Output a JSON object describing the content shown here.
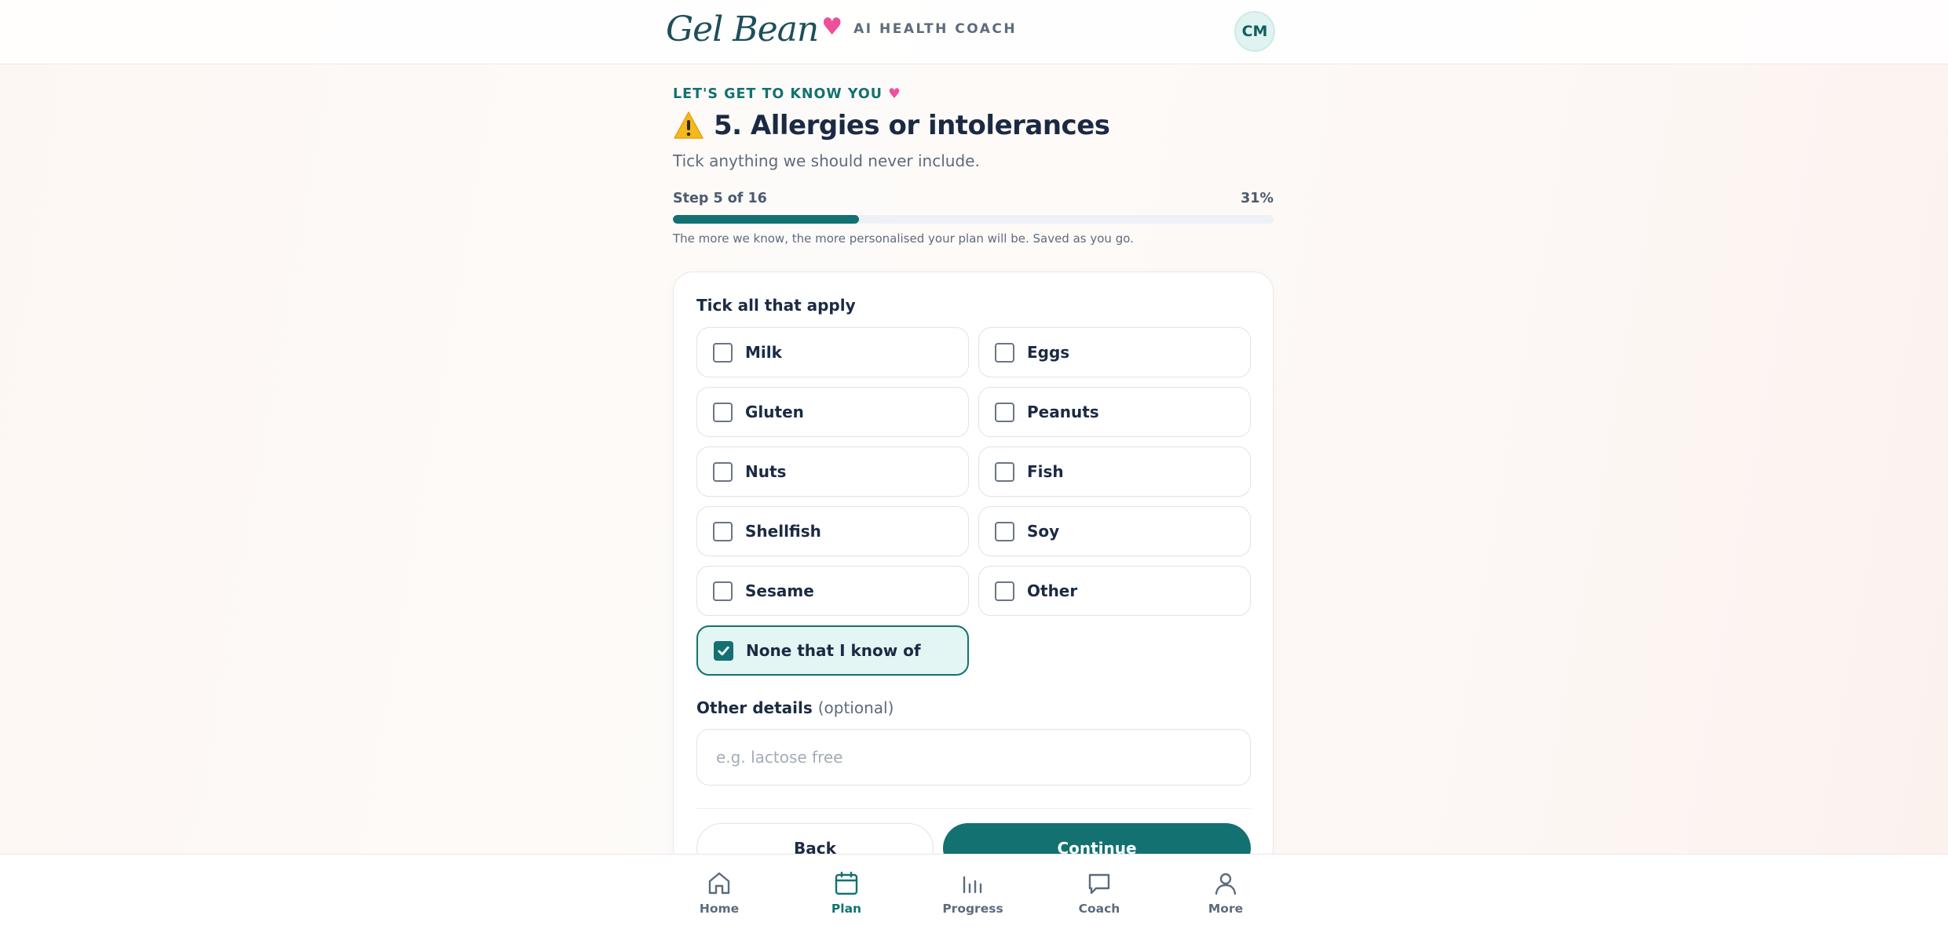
{
  "header": {
    "logo_text": "Gel Bean",
    "logo_subtitle": "AI HEALTH COACH",
    "avatar_initials": "CM"
  },
  "intro": {
    "eyebrow": "LET'S GET TO KNOW YOU",
    "title": "5. Allergies or intolerances",
    "subtitle": "Tick anything we should never include.",
    "step_label": "Step 5 of 16",
    "progress_percent_label": "31%",
    "progress_fraction": 0.31,
    "helper": "The more we know, the more personalised your plan will be. Saved as you go."
  },
  "form": {
    "heading": "Tick all that apply",
    "options": [
      {
        "label": "Milk",
        "checked": false
      },
      {
        "label": "Eggs",
        "checked": false
      },
      {
        "label": "Gluten",
        "checked": false
      },
      {
        "label": "Peanuts",
        "checked": false
      },
      {
        "label": "Nuts",
        "checked": false
      },
      {
        "label": "Fish",
        "checked": false
      },
      {
        "label": "Shellfish",
        "checked": false
      },
      {
        "label": "Soy",
        "checked": false
      },
      {
        "label": "Sesame",
        "checked": false
      },
      {
        "label": "Other",
        "checked": false
      },
      {
        "label": "None that I know of",
        "checked": true
      }
    ],
    "details_label": "Other details",
    "details_optional": "(optional)",
    "details_placeholder": "e.g. lactose free",
    "details_value": "",
    "back_label": "Back",
    "continue_label": "Continue"
  },
  "nav": {
    "items": [
      {
        "label": "Home",
        "icon": "home-icon",
        "active": false
      },
      {
        "label": "Plan",
        "icon": "calendar-icon",
        "active": true
      },
      {
        "label": "Progress",
        "icon": "bar-chart-icon",
        "active": false
      },
      {
        "label": "Coach",
        "icon": "chat-icon",
        "active": false
      },
      {
        "label": "More",
        "icon": "user-icon",
        "active": false
      }
    ]
  },
  "colors": {
    "accent": "#137171",
    "heart": "#f0509a",
    "text": "#1b2a44",
    "muted": "#5e6b7d"
  }
}
